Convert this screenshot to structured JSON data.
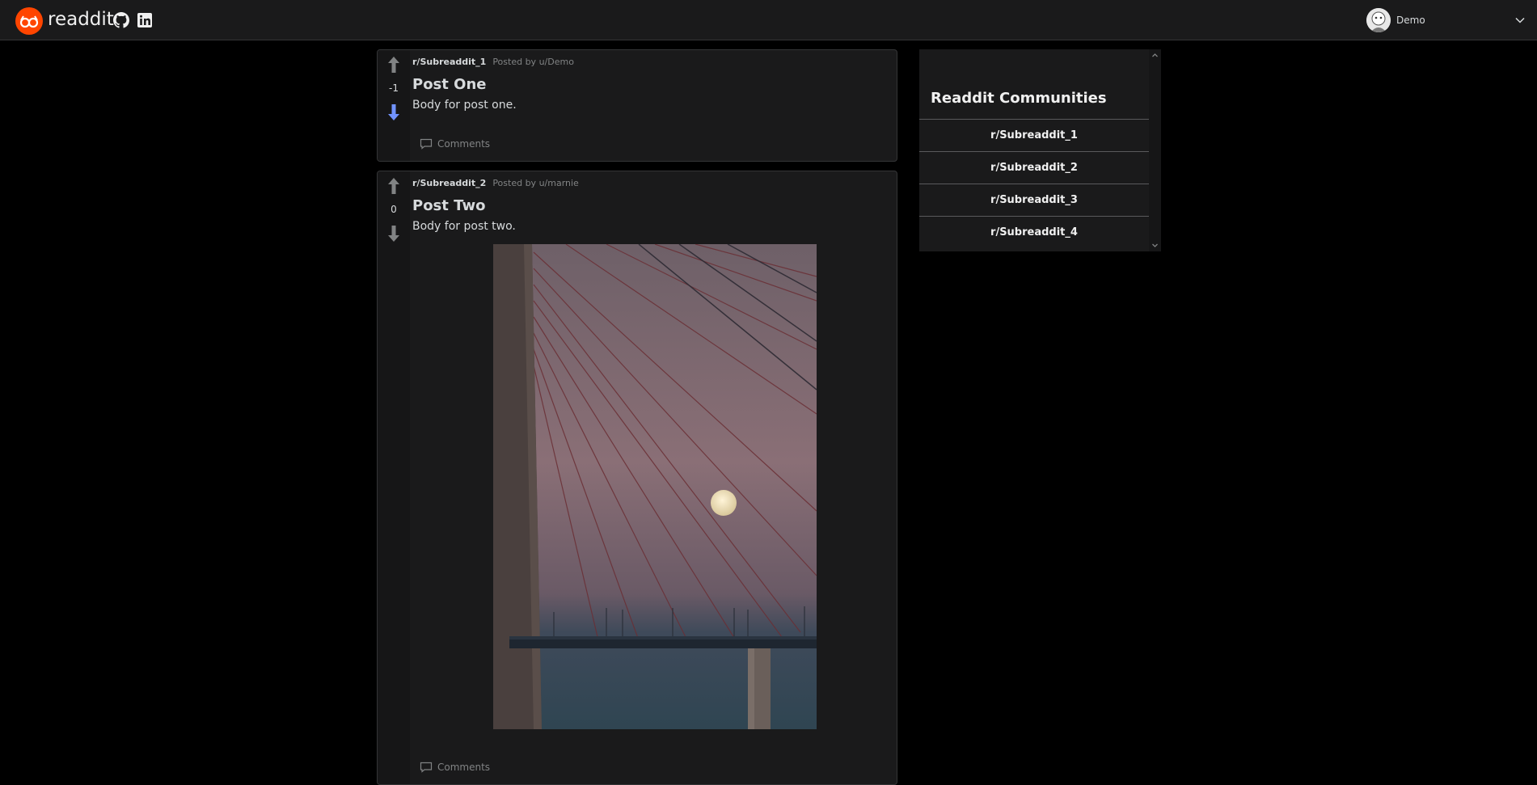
{
  "app": {
    "logo_text": "readdit"
  },
  "header": {
    "user": {
      "name": "Demo"
    }
  },
  "posts": [
    {
      "subreddit": "r/Subreaddit_1",
      "posted_by": "Posted by u/Demo",
      "score": "-1",
      "vote_state": "downvoted",
      "title": "Post One",
      "body": "Body for post one.",
      "comments_label": "Comments"
    },
    {
      "subreddit": "r/Subreaddit_2",
      "posted_by": "Posted by u/marnie",
      "score": "0",
      "vote_state": "none",
      "title": "Post Two",
      "body": "Body for post two.",
      "comments_label": "Comments"
    }
  ],
  "sidebar": {
    "title": "Readdit Communities",
    "items": [
      "r/Subreaddit_1",
      "r/Subreaddit_2",
      "r/Subreaddit_3",
      "r/Subreaddit_4"
    ]
  },
  "colors": {
    "brand": "#ff4500",
    "downvote_active": "#7193ff",
    "arrow_default": "#818384"
  }
}
